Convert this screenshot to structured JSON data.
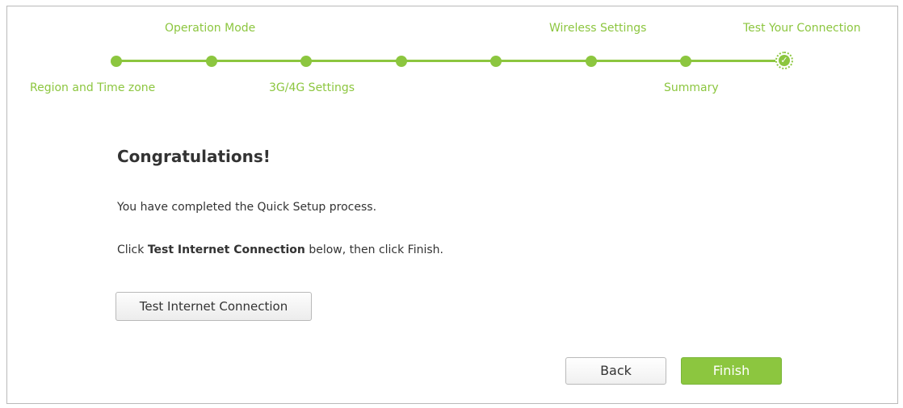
{
  "stepper": {
    "steps_top": [
      "Operation Mode",
      "Wireless Settings",
      "Test Your Connection"
    ],
    "steps_bottom": [
      "Region and Time zone",
      "3G/4G Settings",
      "Summary"
    ],
    "current_step": 8,
    "total_steps": 8,
    "accent_color": "#8cc63f",
    "done_icon": "check-icon"
  },
  "content": {
    "title": "Congratulations!",
    "line1": "You have completed the Quick Setup process.",
    "line2_prefix": "Click ",
    "line2_bold": "Test Internet Connection",
    "line2_suffix": " below, then click Finish."
  },
  "buttons": {
    "test": "Test Internet Connection",
    "back": "Back",
    "finish": "Finish"
  }
}
